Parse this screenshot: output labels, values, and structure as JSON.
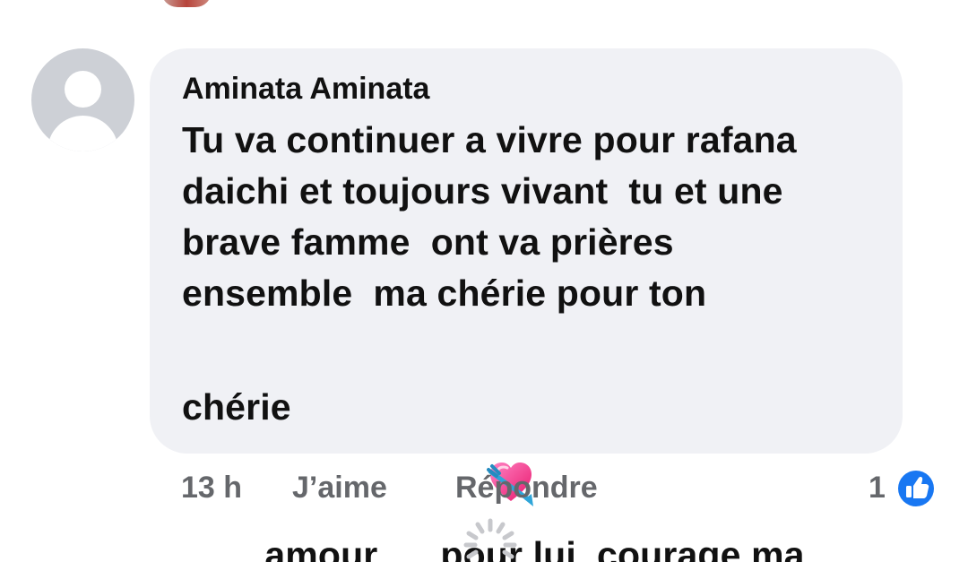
{
  "comment": {
    "author": "Aminata Aminata",
    "lines": [
      "Tu va continuer a vivre pour rafana",
      "daichi et toujours vivant  tu et une",
      "brave famme  ont va prières",
      "ensemble  ma chérie pour ton"
    ],
    "emoji_line": {
      "before": "amour",
      "emoji": "heart-with-arrow-emoji",
      "after": "pour lui  courage ma"
    },
    "last_line": "chérie"
  },
  "meta": {
    "time": "13 h",
    "like_label": "J’aime",
    "reply_label": "Répondre",
    "reaction_count": "1",
    "reaction_icon": "like-thumb-icon",
    "reaction_color": "#1877f2"
  },
  "colors": {
    "bubble": "#f0f1f5",
    "text": "#111111",
    "meta_text": "#65676b",
    "avatar": "#cdd0d6"
  }
}
